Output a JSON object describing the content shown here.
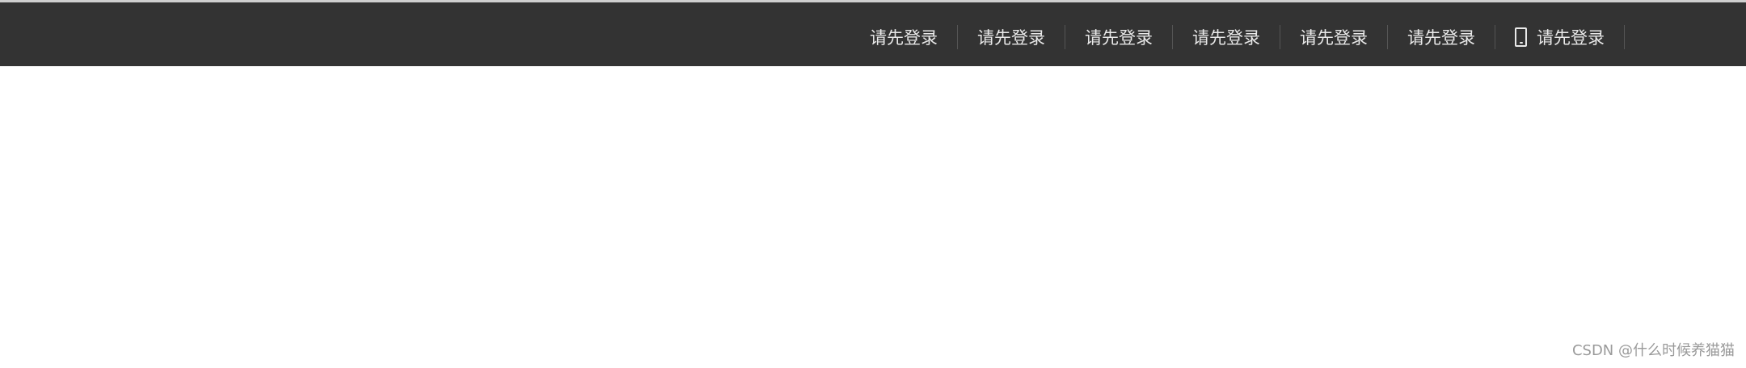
{
  "topbar": {
    "items": [
      {
        "label": "请先登录"
      },
      {
        "label": "请先登录"
      },
      {
        "label": "请先登录"
      },
      {
        "label": "请先登录"
      },
      {
        "label": "请先登录"
      },
      {
        "label": "请先登录"
      },
      {
        "label": "请先登录",
        "icon": "phone-icon"
      }
    ],
    "background": "#333333"
  },
  "watermark": {
    "text": "CSDN @什么时候养猫猫"
  }
}
